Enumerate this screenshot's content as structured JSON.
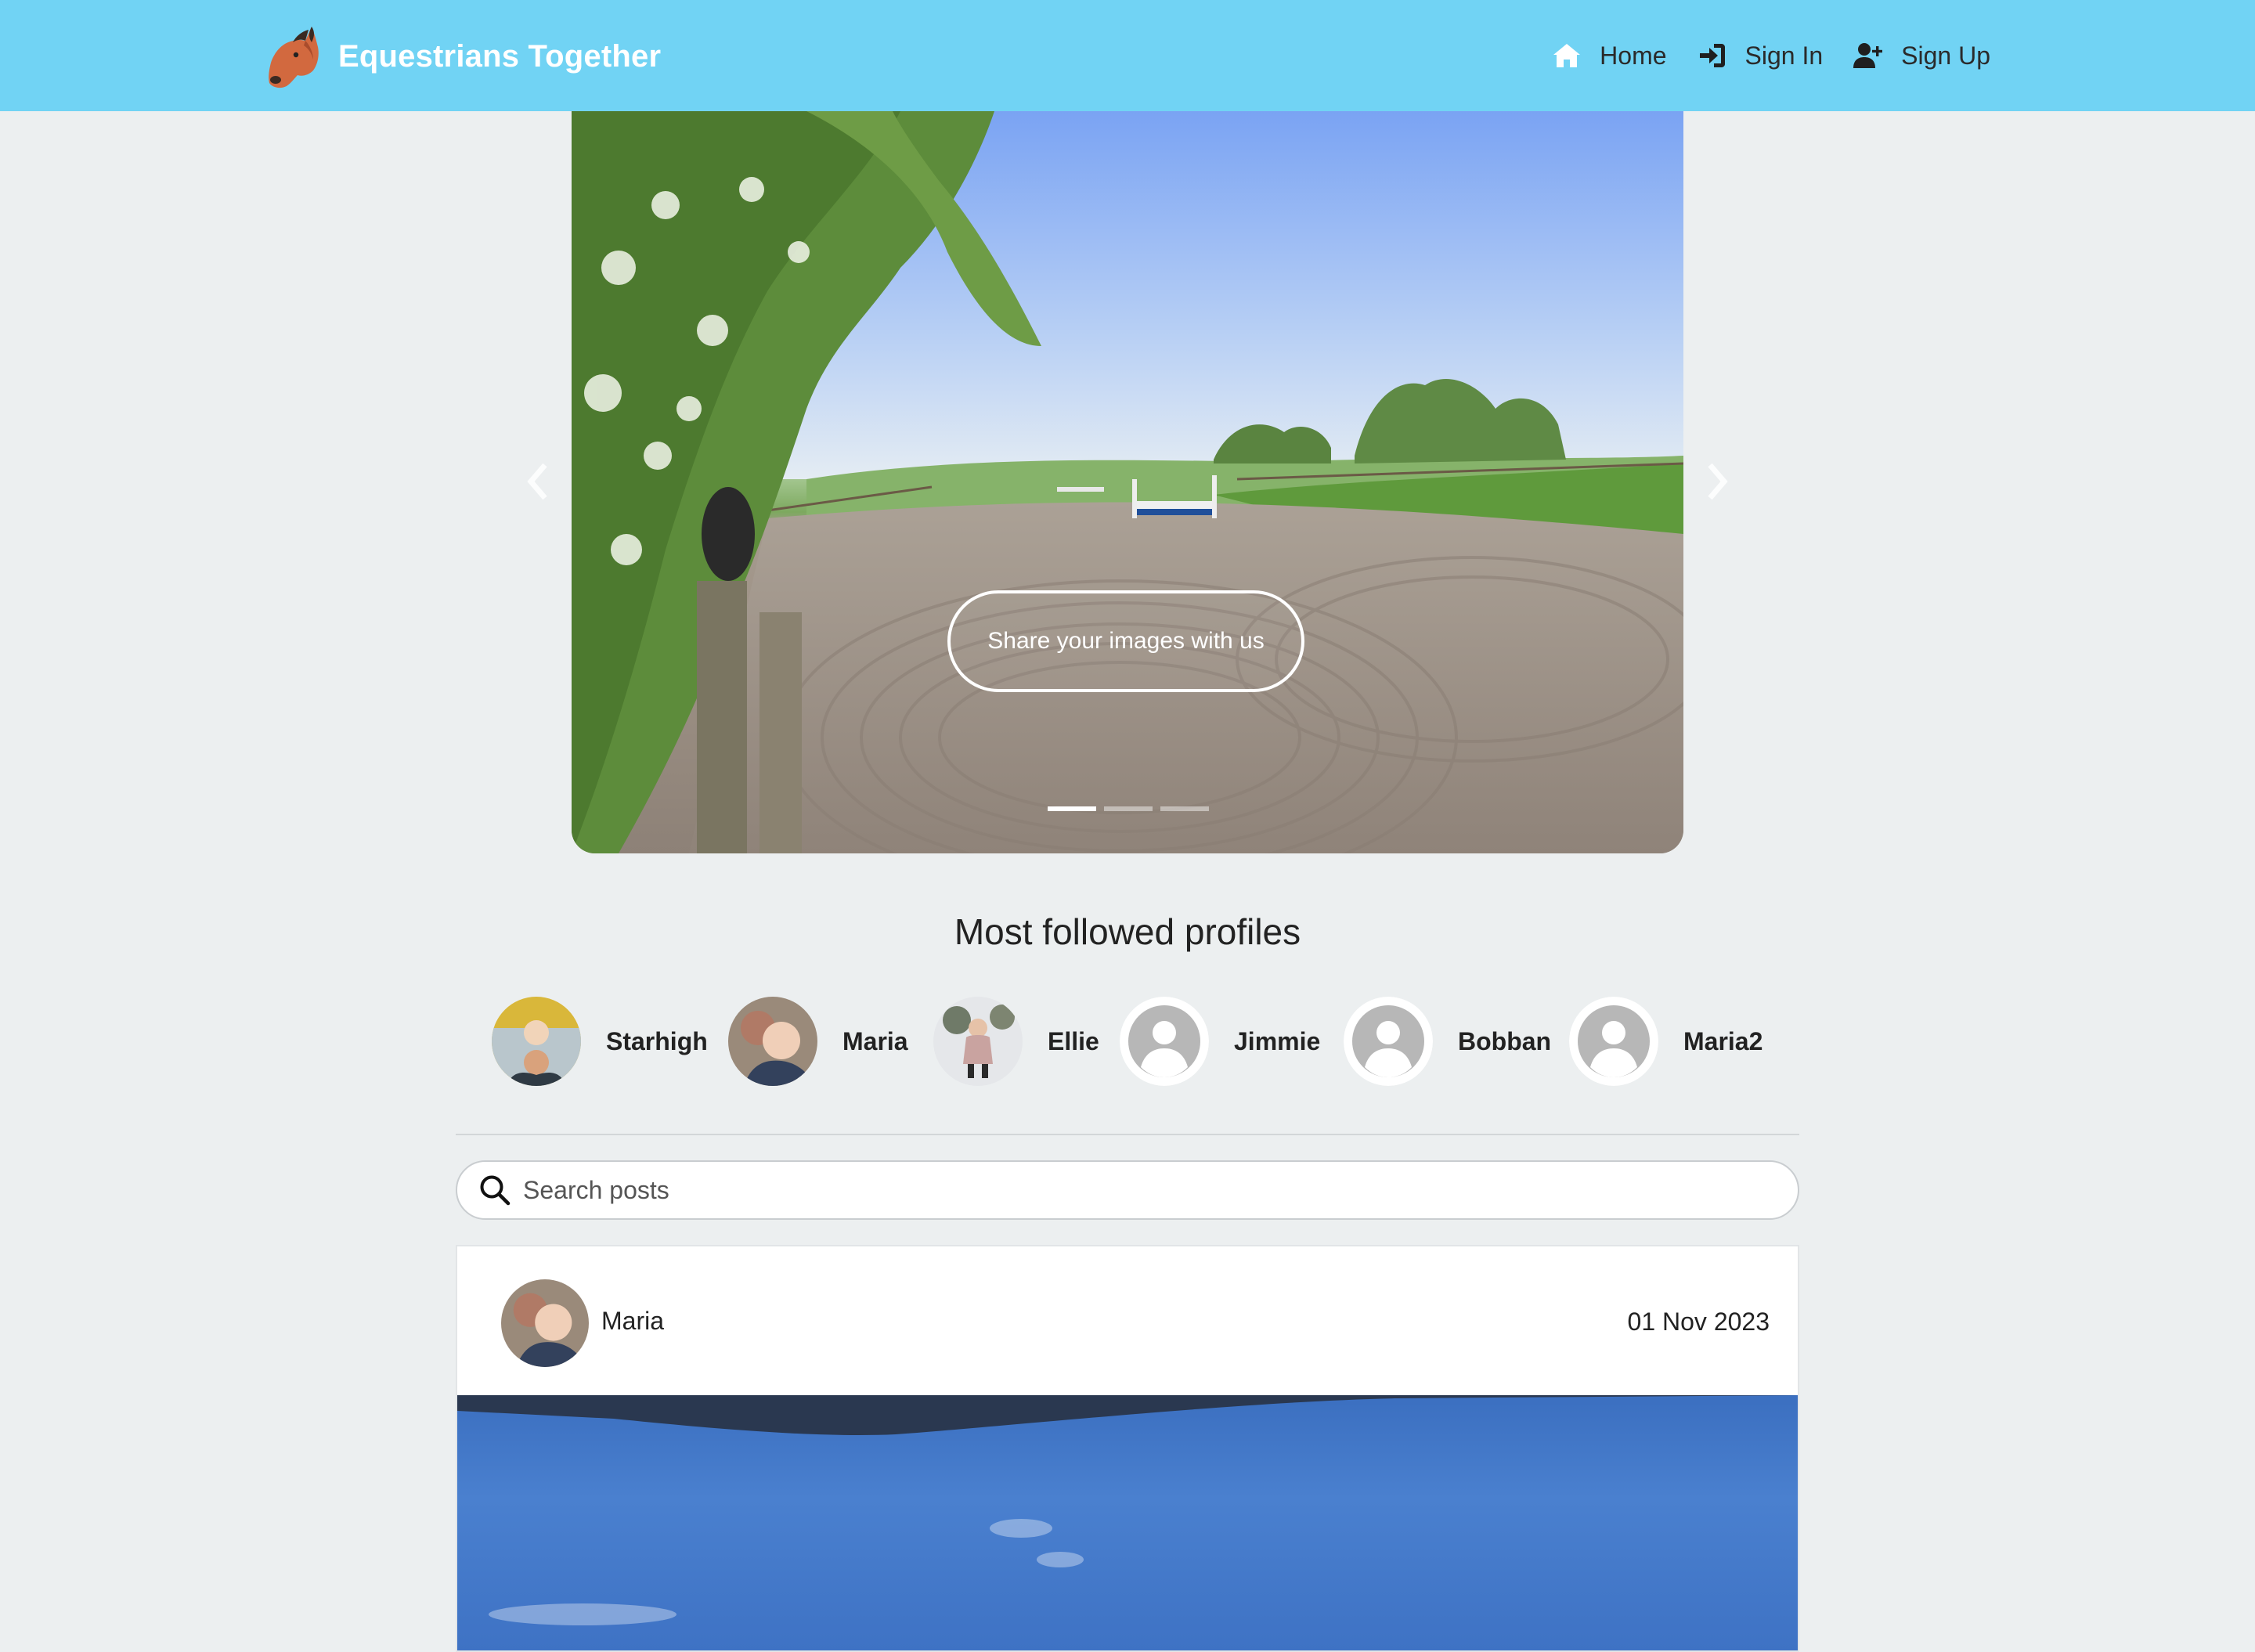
{
  "nav": {
    "brand_title": "Equestrians Together",
    "links": [
      {
        "label": "Home",
        "icon": "home-icon"
      },
      {
        "label": "Sign In",
        "icon": "sign-in-icon"
      },
      {
        "label": "Sign Up",
        "icon": "user-plus-icon"
      }
    ],
    "background_color": "#71d3f4"
  },
  "carousel": {
    "cta_label": "Share your images with us",
    "slide_count": 3,
    "active_slide": 1,
    "prev_icon": "chevron-left-icon",
    "next_icon": "chevron-right-icon"
  },
  "profiles": {
    "title": "Most followed profiles",
    "items": [
      {
        "name": "Starhigh",
        "avatar": "photo"
      },
      {
        "name": "Maria",
        "avatar": "photo"
      },
      {
        "name": "Ellie",
        "avatar": "photo"
      },
      {
        "name": "Jimmie",
        "avatar": "default-user-icon"
      },
      {
        "name": "Bobban",
        "avatar": "default-user-icon"
      },
      {
        "name": "Maria2",
        "avatar": "default-user-icon"
      }
    ]
  },
  "search": {
    "placeholder": "Search posts",
    "value": ""
  },
  "posts": [
    {
      "author": "Maria",
      "date": "01 Nov 2023"
    }
  ]
}
